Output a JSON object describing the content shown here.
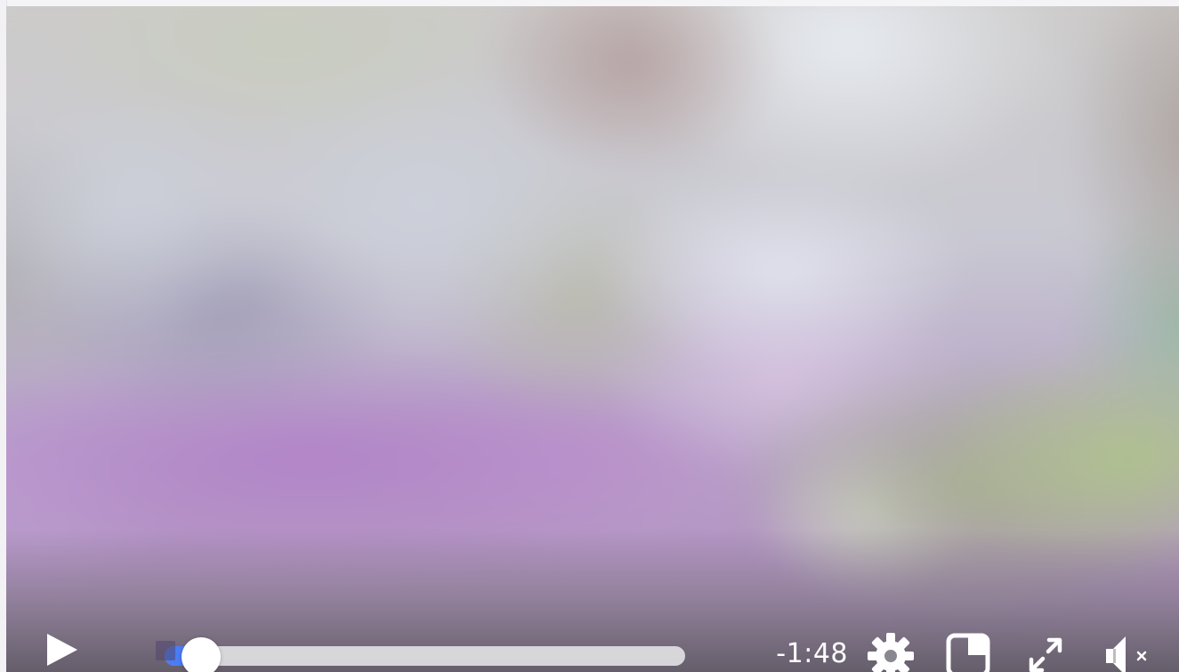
{
  "player": {
    "state": "paused",
    "muted": true,
    "progress": 0.07,
    "time_remaining": "-1:48",
    "accent_color": "#4b7cf3"
  },
  "controls": {
    "play": {
      "icon": "play-icon"
    },
    "settings": {
      "icon": "gear-icon"
    },
    "pip": {
      "icon": "picture-in-picture-icon"
    },
    "fullscreen": {
      "icon": "expand-icon"
    },
    "mute": {
      "icon": "speaker-muted-icon"
    }
  }
}
